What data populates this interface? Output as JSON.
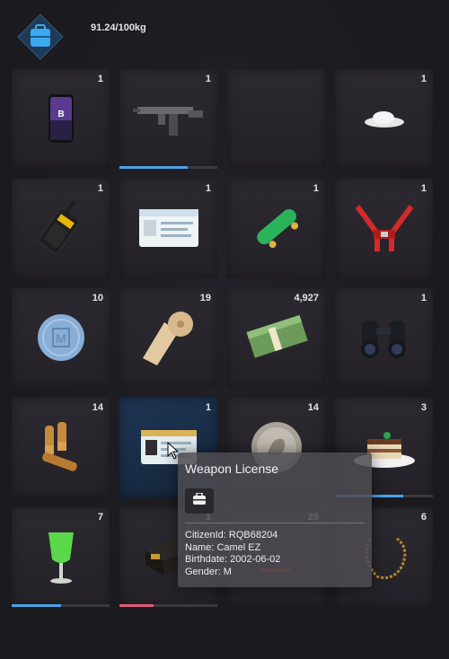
{
  "header": {
    "weight_text": "91.24/100kg",
    "icon": "backpack-icon"
  },
  "slots": [
    {
      "name": "phone",
      "count": "1",
      "icon": "phone-icon"
    },
    {
      "name": "smg",
      "count": "1",
      "icon": "uzi-smg-icon",
      "durability": 0.7,
      "bar_color": "#4aa3e8"
    },
    {
      "name": "empty",
      "count": "",
      "icon": ""
    },
    {
      "name": "powder",
      "count": "1",
      "icon": "white-powder-icon"
    },
    {
      "name": "radio",
      "count": "1",
      "icon": "walkie-talkie-icon"
    },
    {
      "name": "id-card",
      "count": "1",
      "icon": "id-card-icon"
    },
    {
      "name": "skateboard",
      "count": "1",
      "icon": "skateboard-icon"
    },
    {
      "name": "harness",
      "count": "1",
      "icon": "racing-harness-icon"
    },
    {
      "name": "pill",
      "count": "10",
      "icon": "blue-pill-icon"
    },
    {
      "name": "bandage",
      "count": "19",
      "icon": "bandage-roll-icon"
    },
    {
      "name": "cash",
      "count": "4,927",
      "icon": "cash-stack-icon"
    },
    {
      "name": "binoculars",
      "count": "1",
      "icon": "binoculars-icon"
    },
    {
      "name": "bullets",
      "count": "14",
      "icon": "bullets-icon"
    },
    {
      "name": "weapon-license",
      "count": "1",
      "icon": "license-card-icon",
      "selected": true
    },
    {
      "name": "coin",
      "count": "14",
      "icon": "silver-coin-icon"
    },
    {
      "name": "tiramisu",
      "count": "3",
      "icon": "cake-plate-icon",
      "durability": 0.7,
      "bar_color": "#4aa3e8"
    },
    {
      "name": "drink",
      "count": "7",
      "icon": "green-cocktail-icon",
      "durability": 0.5,
      "bar_color": "#4aa3e8"
    },
    {
      "name": "box",
      "count": "1",
      "icon": "dark-box-icon",
      "durability": 0.35,
      "bar_color": "#e05a7a"
    },
    {
      "name": "item-19",
      "count": "25",
      "icon": "red-item-icon"
    },
    {
      "name": "chain",
      "count": "6",
      "icon": "gold-chain-icon"
    }
  ],
  "tooltip": {
    "title": "Weapon License",
    "icon": "backpack-icon",
    "lines": [
      "CitizenId: RQB68204",
      "Name: Camel EZ",
      "Birthdate: 2002-06-02",
      "Gender: M"
    ]
  }
}
